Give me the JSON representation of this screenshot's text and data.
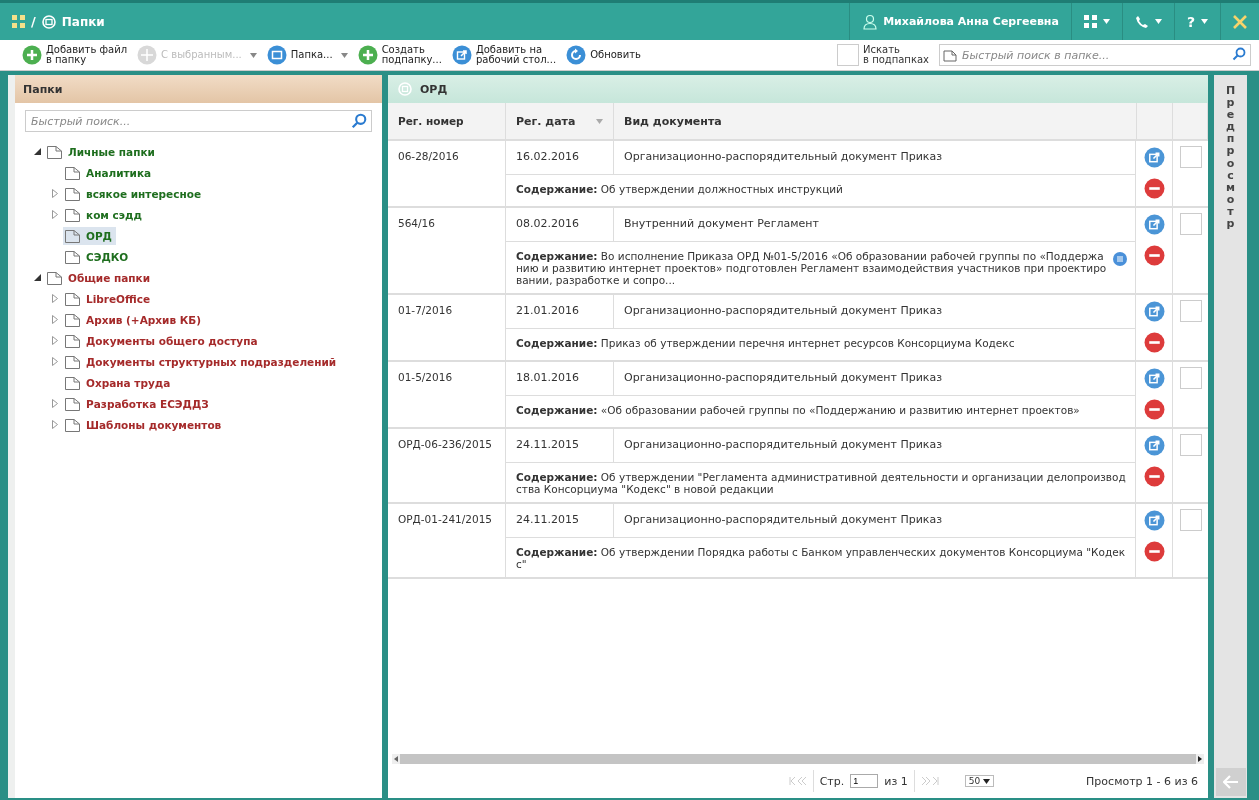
{
  "window": {
    "separator": "/",
    "title": "Папки",
    "user": "Михайлова Анна Сергеевна",
    "help_label": "?"
  },
  "toolbar": [
    {
      "kind": "add",
      "label": "Добавить файл\nв папку",
      "disabled": false,
      "dropdown": false
    },
    {
      "kind": "selection",
      "label": "С выбранным...",
      "disabled": true,
      "dropdown": true
    },
    {
      "kind": "folder",
      "label": "Папка...",
      "disabled": false,
      "dropdown": true
    },
    {
      "kind": "add",
      "label": "Создать\nподпапку...",
      "disabled": false,
      "dropdown": false
    },
    {
      "kind": "desktop",
      "label": "Добавить на\nрабочий стол...",
      "disabled": false,
      "dropdown": false
    },
    {
      "kind": "refresh",
      "label": "Обновить",
      "disabled": false,
      "dropdown": false
    }
  ],
  "subfolder_search": {
    "label": "Искать\nв подпапках",
    "checked": false
  },
  "folder_search": {
    "placeholder": "Быстрый поиск в папке..."
  },
  "sidebar": {
    "title": "Папки",
    "search": {
      "placeholder": "Быстрый поиск..."
    },
    "items": [
      {
        "label": "Личные папки",
        "color": "#1e6e1e",
        "expanded": true,
        "selected": false,
        "children": [
          {
            "label": "Аналитика",
            "selected": false
          },
          {
            "label": "всякое интересное",
            "expanded": false,
            "selected": false
          },
          {
            "label": "ком сэдд",
            "expanded": false,
            "selected": false
          },
          {
            "label": "ОРД",
            "selected": true
          },
          {
            "label": "СЭДКО",
            "selected": false
          }
        ]
      },
      {
        "label": "Общие папки",
        "color": "#a52a2a",
        "expanded": true,
        "selected": false,
        "children": [
          {
            "label": "LibreOffice",
            "expanded": false,
            "selected": false
          },
          {
            "label": "Архив (+Архив КБ)",
            "expanded": false,
            "selected": false
          },
          {
            "label": "Документы общего доступа",
            "expanded": false,
            "selected": false
          },
          {
            "label": "Документы структурных подразделений",
            "expanded": false,
            "selected": false
          },
          {
            "label": "Охрана труда",
            "selected": false
          },
          {
            "label": "Разработка ЕСЭДДЗ",
            "expanded": false,
            "selected": false
          },
          {
            "label": "Шаблоны документов",
            "expanded": false,
            "selected": false
          }
        ]
      }
    ]
  },
  "main": {
    "title": "ОРД",
    "columns": [
      "Рег. номер",
      "Рег. дата",
      "Вид документа"
    ],
    "rows": [
      {
        "reg_number": "06-28/2016",
        "reg_date": "16.02.2016",
        "doc_type": "Организационно-распорядительный документ Приказ",
        "content": "**Содержание:** Об утверждении должностных инструкций",
        "note": false,
        "checked": false
      },
      {
        "reg_number": "564/16",
        "reg_date": "08.02.2016",
        "doc_type": "Внутренний документ Регламент",
        "content": "**Содержание:** Во исполнение Приказа ОРД №01-5/2016 «Об образовании рабочей группы по «Поддержанию и развитию интернет проектов» подготовлен Регламент взаимодействия участников при проектировании, разработке и сопро...",
        "note": true,
        "checked": false
      },
      {
        "reg_number": "01-7/2016",
        "reg_date": "21.01.2016",
        "doc_type": "Организационно-распорядительный документ Приказ",
        "content": "**Содержание:** Приказ об утверждении перечня интернет ресурсов Консорциума Кодекс",
        "note": false,
        "checked": false
      },
      {
        "reg_number": "01-5/2016",
        "reg_date": "18.01.2016",
        "doc_type": "Организационно-распорядительный документ Приказ",
        "content": "**Содержание:** «Об образовании рабочей группы по «Поддержанию и развитию интернет проектов»",
        "note": false,
        "checked": false
      },
      {
        "reg_number": "ОРД-06-236/2015",
        "reg_date": "24.11.2015",
        "doc_type": "Организационно-распорядительный документ Приказ",
        "content": "**Содержание:** Об утверждении \"Регламента административной деятельности и организации делопроизводства Консорциума \"Кодекс\" в новой редакции",
        "note": false,
        "checked": false
      },
      {
        "reg_number": "ОРД-01-241/2015",
        "reg_date": "24.11.2015",
        "doc_type": "Организационно-распорядительный документ Приказ",
        "content": "**Содержание:** Об утверждении Порядка работы с Банком управленческих документов Консорциума \"Кодекс\"",
        "note": false,
        "checked": false
      }
    ],
    "pager": {
      "page_label": "Стр.",
      "page": "1",
      "of": "из 1",
      "page_size": "50",
      "summary": "Просмотр 1 - 6 из 6",
      "first_disabled": true,
      "last_disabled": true
    }
  },
  "preview": {
    "label": "Предпросмотр"
  }
}
